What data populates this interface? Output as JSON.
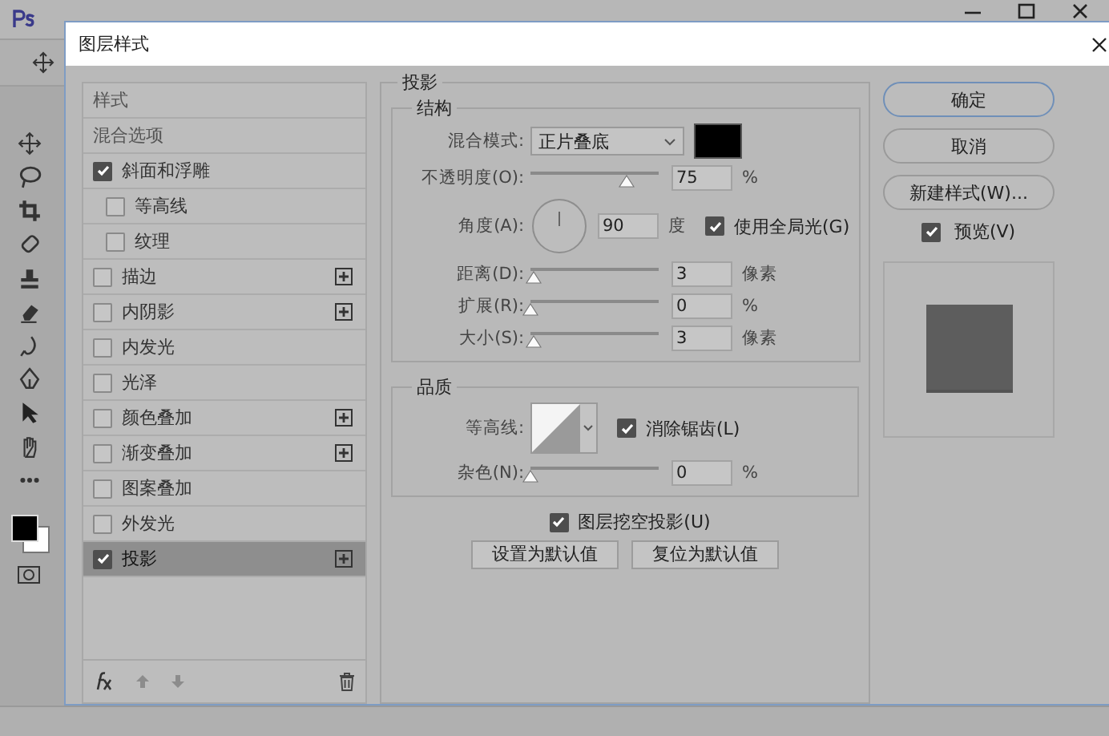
{
  "dialog": {
    "title": "图层样式",
    "styles": [
      {
        "kind": "header",
        "label": "样式",
        "selected": false
      },
      {
        "kind": "header",
        "label": "混合选项",
        "selected": false
      },
      {
        "kind": "effect",
        "label": "斜面和浮雕",
        "checked": true,
        "selected": false,
        "addable": false,
        "children": [
          {
            "kind": "effect",
            "label": "等高线",
            "checked": false,
            "selected": false,
            "addable": false
          },
          {
            "kind": "effect",
            "label": "纹理",
            "checked": false,
            "selected": false,
            "addable": false
          }
        ]
      },
      {
        "kind": "effect",
        "label": "描边",
        "checked": false,
        "selected": false,
        "addable": true
      },
      {
        "kind": "effect",
        "label": "内阴影",
        "checked": false,
        "selected": false,
        "addable": true
      },
      {
        "kind": "effect",
        "label": "内发光",
        "checked": false,
        "selected": false,
        "addable": false
      },
      {
        "kind": "effect",
        "label": "光泽",
        "checked": false,
        "selected": false,
        "addable": false
      },
      {
        "kind": "effect",
        "label": "颜色叠加",
        "checked": false,
        "selected": false,
        "addable": true
      },
      {
        "kind": "effect",
        "label": "渐变叠加",
        "checked": false,
        "selected": false,
        "addable": true
      },
      {
        "kind": "effect",
        "label": "图案叠加",
        "checked": false,
        "selected": false,
        "addable": false
      },
      {
        "kind": "effect",
        "label": "外发光",
        "checked": false,
        "selected": false,
        "addable": false
      },
      {
        "kind": "effect",
        "label": "投影",
        "checked": true,
        "selected": true,
        "addable": true
      }
    ],
    "panel": {
      "title": "投影",
      "structure": {
        "title": "结构",
        "rows": [
          {
            "kind": "select",
            "label": "混合模式:",
            "value": "正片叠底",
            "color": "#000000"
          },
          {
            "kind": "slider",
            "label": "不透明度(O):",
            "level": 0.75,
            "value": "75",
            "unit": "%"
          },
          {
            "kind": "angle",
            "label": "角度(A):",
            "value": "90",
            "unit": "度",
            "option": {
              "label": "使用全局光(G)",
              "checked": true
            }
          },
          {
            "kind": "slider",
            "label": "距离(D):",
            "level": 0.03,
            "value": "3",
            "unit": "像素"
          },
          {
            "kind": "slider",
            "label": "扩展(R):",
            "level": 0,
            "value": "0",
            "unit": "%"
          },
          {
            "kind": "slider",
            "label": "大小(S):",
            "level": 0.03,
            "value": "3",
            "unit": "像素"
          }
        ]
      },
      "quality": {
        "title": "品质",
        "rows": [
          {
            "kind": "contour",
            "label": "等高线:",
            "option": {
              "label": "消除锯齿(L)",
              "checked": true
            }
          },
          {
            "kind": "slider",
            "label": "杂色(N):",
            "level": 0,
            "value": "0",
            "unit": "%"
          }
        ]
      },
      "knockout": {
        "label": "图层挖空投影(U)",
        "checked": true
      },
      "buttons": [
        "设置为默认值",
        "复位为默认值"
      ]
    },
    "actions": [
      {
        "label": "确定",
        "kind": "primary"
      },
      {
        "label": "取消",
        "kind": "normal"
      },
      {
        "label": "新建样式(W)...",
        "kind": "normal"
      }
    ],
    "preview": {
      "label": "预览(V)",
      "checked": true
    }
  }
}
